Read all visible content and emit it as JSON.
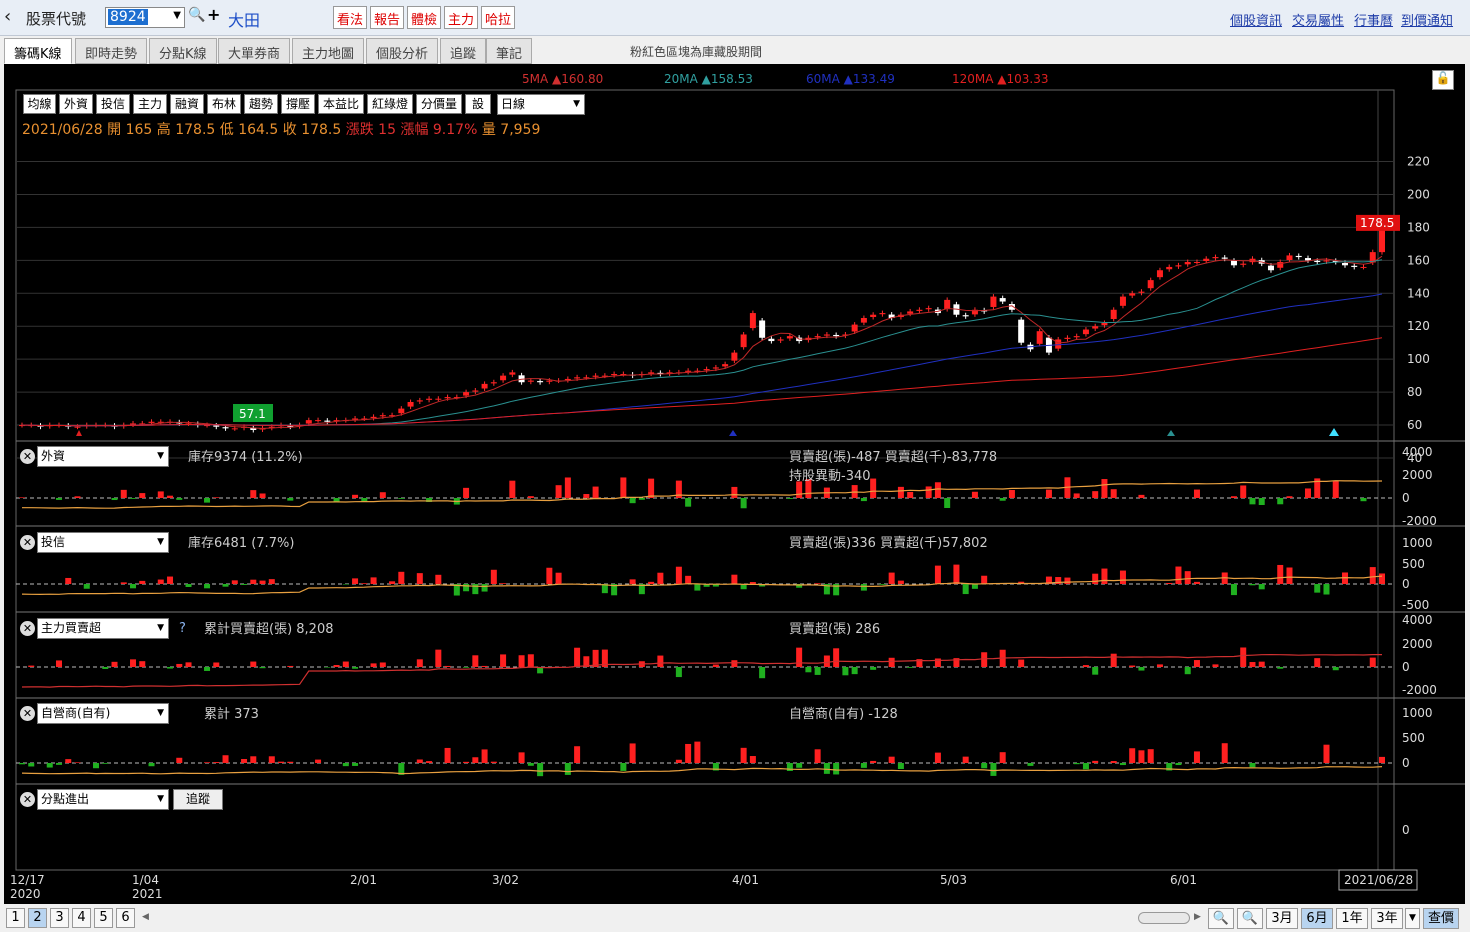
{
  "header": {
    "back": "‹",
    "stock_label": "股票代號",
    "code": "8924",
    "name": "大田",
    "buttons": [
      "看法",
      "報告",
      "體檢",
      "主力",
      "哈拉"
    ],
    "links": [
      "個股資訊",
      "交易屬性",
      "行事曆",
      "到價通知"
    ]
  },
  "tabs": [
    "籌碼K線",
    "即時走勢",
    "分點K線",
    "大單券商",
    "主力地圖",
    "個股分析",
    "追蹤",
    "筆記"
  ],
  "tab_note": "粉紅色區塊為庫藏股期間",
  "ma_legend": [
    {
      "label": "5MA ▲160.80",
      "color": "#d03030"
    },
    {
      "label": "20MA ▲158.53",
      "color": "#30a0a0"
    },
    {
      "label": "60MA ▲133.49",
      "color": "#2030c0"
    },
    {
      "label": "120MA ▲103.33",
      "color": "#e02020"
    }
  ],
  "toolbar": [
    "均線",
    "外資",
    "投信",
    "主力",
    "融資",
    "布林",
    "趨勢",
    "撐壓",
    "本益比",
    "紅綠燈",
    "分價量",
    "設"
  ],
  "period_select": "日線",
  "ohlc": {
    "date": "2021/06/28",
    "open": "開 165",
    "high": "高 178.5",
    "low": "低 164.5",
    "close": "收 178.5",
    "change": "漲跌 15",
    "pct": "漲幅 9.17%",
    "vol": "量 7,959"
  },
  "price_axis": [
    "220",
    "200",
    "180",
    "160",
    "140",
    "120",
    "100",
    "80",
    "60",
    "40"
  ],
  "last_price": "178.5",
  "low_price": "57.1",
  "panels": [
    {
      "select": "外資",
      "left": "庫存9374 (11.2%)",
      "right": "買賣超(張)-487 買賣超(千)-83,778",
      "right2": "持股異動-340",
      "axis": [
        "4000",
        "2000",
        "0",
        "-2000"
      ]
    },
    {
      "select": "投信",
      "left": "庫存6481 (7.7%)",
      "right": "買賣超(張)336 買賣超(千)57,802",
      "axis": [
        "1000",
        "500",
        "0",
        "-500"
      ]
    },
    {
      "select": "主力買賣超",
      "q": "?",
      "left": "累計買賣超(張) 8,208",
      "right": "買賣超(張) 286",
      "axis": [
        "4000",
        "2000",
        "0",
        "-2000"
      ]
    },
    {
      "select": "自營商(自有)",
      "left": "累計 373",
      "right": "自營商(自有) -128",
      "axis": [
        "1000",
        "500",
        "0"
      ]
    },
    {
      "select": "分點進出",
      "btn": "追蹤",
      "axis": [
        "0"
      ]
    }
  ],
  "date_axis": [
    {
      "l1": "12/17",
      "l2": "2020"
    },
    {
      "l1": "1/04",
      "l2": "2021"
    },
    {
      "l1": "2/01",
      "l2": ""
    },
    {
      "l1": "3/02",
      "l2": ""
    },
    {
      "l1": "4/01",
      "l2": ""
    },
    {
      "l1": "5/03",
      "l2": ""
    },
    {
      "l1": "6/01",
      "l2": ""
    },
    {
      "l1": "2021/06/28",
      "l2": ""
    }
  ],
  "pages": [
    "1",
    "2",
    "3",
    "4",
    "5",
    "6"
  ],
  "ranges": [
    "3月",
    "6月",
    "1年",
    "3年"
  ],
  "query": "查價",
  "chart_data": {
    "type": "candlestick",
    "closes": [
      60,
      60,
      59,
      60,
      60,
      59,
      59,
      60,
      60,
      60,
      59,
      60,
      61,
      61,
      62,
      62,
      62,
      61,
      61,
      60,
      60,
      59,
      58,
      58,
      59,
      57,
      58,
      59,
      60,
      59,
      60,
      63,
      63,
      62,
      63,
      63,
      64,
      64,
      65,
      66,
      66,
      70,
      74,
      75,
      76,
      76,
      77,
      77,
      80,
      81,
      85,
      86,
      90,
      92,
      86,
      87,
      86,
      87,
      87,
      88,
      89,
      89,
      90,
      90,
      91,
      91,
      90,
      91,
      92,
      91,
      92,
      92,
      93,
      93,
      94,
      95,
      97,
      104,
      115,
      128,
      113,
      111,
      112,
      114,
      111,
      113,
      114,
      115,
      114,
      115,
      121,
      125,
      127,
      128,
      125,
      127,
      129,
      130,
      131,
      128,
      136,
      127,
      126,
      130,
      129,
      138,
      135,
      130,
      110,
      106,
      117,
      104,
      112,
      113,
      114,
      118,
      120,
      122,
      130,
      138,
      140,
      141,
      148,
      154,
      156,
      157,
      159,
      159,
      161,
      162,
      161,
      157,
      158,
      161,
      158,
      154,
      159,
      163,
      162,
      160,
      159,
      160,
      159,
      157,
      156,
      156,
      165,
      178.5
    ],
    "ma_last": {
      "5MA": 160.8,
      "20MA": 158.53,
      "60MA": 133.49,
      "120MA": 103.33
    },
    "foreign_last": -487,
    "trust_last": 336,
    "main_last": 286,
    "dealer_last": -128
  }
}
